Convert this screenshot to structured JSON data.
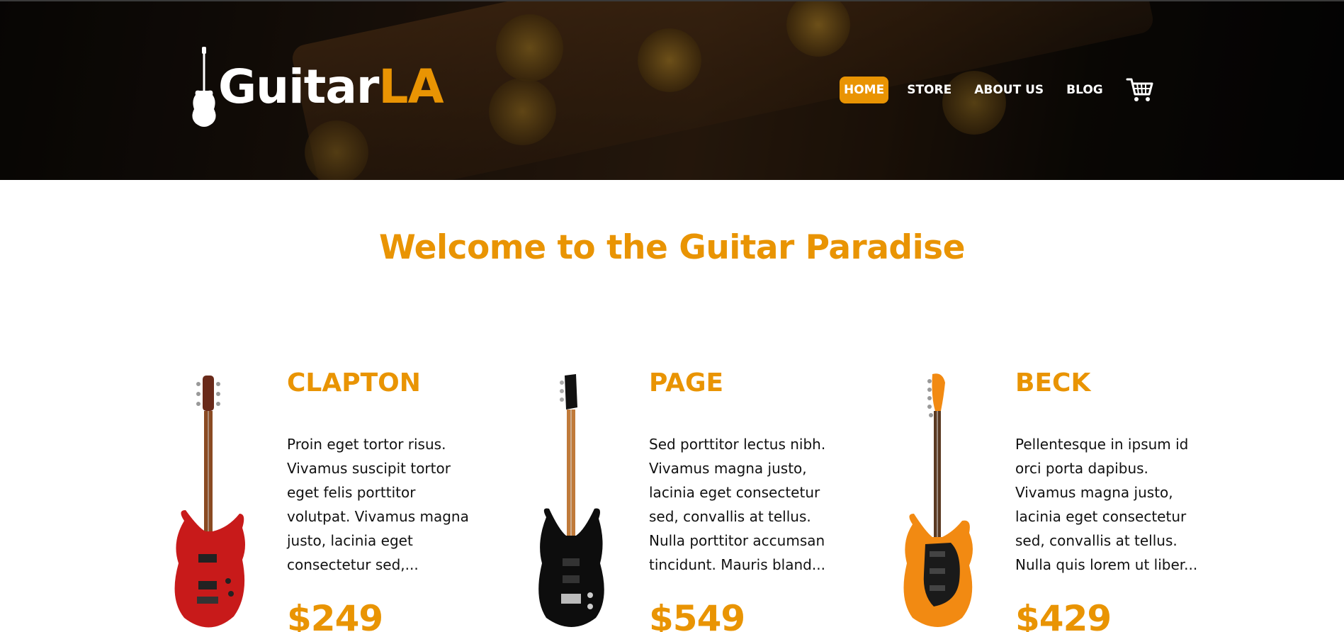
{
  "logo": {
    "part1": "Guitar",
    "part2": "LA"
  },
  "nav": {
    "items": [
      {
        "label": "HOME",
        "active": true
      },
      {
        "label": "STORE",
        "active": false
      },
      {
        "label": "ABOUT US",
        "active": false
      },
      {
        "label": "BLOG",
        "active": false
      }
    ],
    "cart_icon": "shopping-cart-icon"
  },
  "main": {
    "heading": "Welcome to the Guitar Paradise"
  },
  "products": [
    {
      "name": "CLAPTON",
      "description": "Proin eget tortor risus. Vivamus suscipit tortor eget felis porttitor volutpat. Vivamus magna justo, lacinia eget consectetur sed,...",
      "price": "$249",
      "body_color": "#c81a1a"
    },
    {
      "name": "PAGE",
      "description": "Sed porttitor lectus nibh. Vivamus magna justo, lacinia eget consectetur sed, convallis at tellus. Nulla porttitor accumsan tincidunt. Mauris bland...",
      "price": "$549",
      "body_color": "#0d0d0d"
    },
    {
      "name": "BECK",
      "description": "Pellentesque in ipsum id orci porta dapibus. Vivamus magna justo, lacinia eget consectetur sed, convallis at tellus. Nulla quis lorem ut liber...",
      "price": "$429",
      "body_color": "#f28a12"
    }
  ],
  "colors": {
    "accent": "#e99403"
  }
}
